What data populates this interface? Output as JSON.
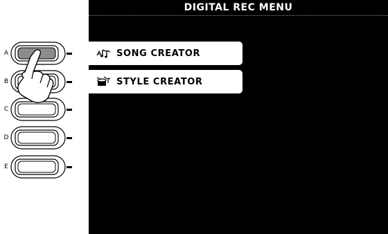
{
  "screen": {
    "title": "DIGITAL REC MENU",
    "menu_items": [
      {
        "label": "SONG CREATOR",
        "icon": "song-creator-icon"
      },
      {
        "label": "STYLE CREATOR",
        "icon": "style-creator-icon"
      }
    ]
  },
  "side_buttons": {
    "labels": [
      "A",
      "B",
      "C",
      "D",
      "E"
    ]
  },
  "colors": {
    "screen_bg": "#000000",
    "menu_bg": "#ffffff",
    "pressed_button": "#8c8c8c"
  }
}
